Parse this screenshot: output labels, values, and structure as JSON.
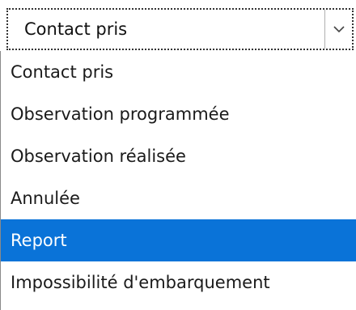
{
  "select": {
    "value": "Contact pris",
    "arrow_icon": "chevron-down-icon"
  },
  "options": [
    {
      "label": "Contact pris",
      "highlighted": false
    },
    {
      "label": "Observation programmée",
      "highlighted": false
    },
    {
      "label": "Observation réalisée",
      "highlighted": false
    },
    {
      "label": "Annulée",
      "highlighted": false
    },
    {
      "label": "Report",
      "highlighted": true
    },
    {
      "label": "Impossibilité d'embarquement",
      "highlighted": false
    }
  ],
  "colors": {
    "highlight": "#0a73d8",
    "highlight_text": "#ffffff",
    "text": "#1a1a1a"
  }
}
